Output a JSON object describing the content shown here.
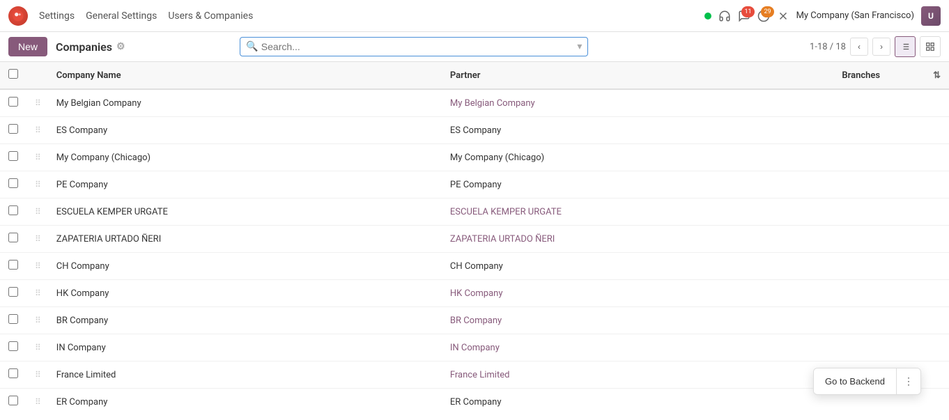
{
  "nav": {
    "logo": "O",
    "items": [
      "Settings",
      "General Settings",
      "Users & Companies"
    ],
    "company": "My Company (San Francisco)",
    "badges": {
      "chat": "11",
      "activity": "29"
    },
    "statusColor": "#00c04b"
  },
  "toolbar": {
    "new_label": "New",
    "page_title": "Companies",
    "search_placeholder": "Search...",
    "pagination": "1-18 / 18",
    "view_list_label": "List View",
    "view_kanban_label": "Kanban View"
  },
  "table": {
    "headers": {
      "company_name": "Company Name",
      "partner": "Partner",
      "branches": "Branches"
    },
    "rows": [
      {
        "company": "My Belgian Company",
        "partner": "My Belgian Company",
        "partner_link": true,
        "branches": ""
      },
      {
        "company": "ES Company",
        "partner": "ES Company",
        "partner_link": false,
        "branches": ""
      },
      {
        "company": "My Company (Chicago)",
        "partner": "My Company (Chicago)",
        "partner_link": false,
        "branches": ""
      },
      {
        "company": "PE Company",
        "partner": "PE Company",
        "partner_link": false,
        "branches": ""
      },
      {
        "company": "ESCUELA KEMPER URGATE",
        "partner": "ESCUELA KEMPER URGATE",
        "partner_link": true,
        "branches": ""
      },
      {
        "company": "ZAPATERIA URTADO ÑERI",
        "partner": "ZAPATERIA URTADO ÑERI",
        "partner_link": true,
        "branches": ""
      },
      {
        "company": "CH Company",
        "partner": "CH Company",
        "partner_link": false,
        "branches": ""
      },
      {
        "company": "HK Company",
        "partner": "HK Company",
        "partner_link": true,
        "branches": ""
      },
      {
        "company": "BR Company",
        "partner": "BR Company",
        "partner_link": true,
        "branches": ""
      },
      {
        "company": "IN Company",
        "partner": "IN Company",
        "partner_link": true,
        "branches": ""
      },
      {
        "company": "France Limited",
        "partner": "France Limited",
        "partner_link": true,
        "branches": ""
      },
      {
        "company": "ER Company",
        "partner": "ER Company",
        "partner_link": false,
        "branches": ""
      }
    ]
  },
  "goto_backend": {
    "label": "Go to Backend"
  }
}
